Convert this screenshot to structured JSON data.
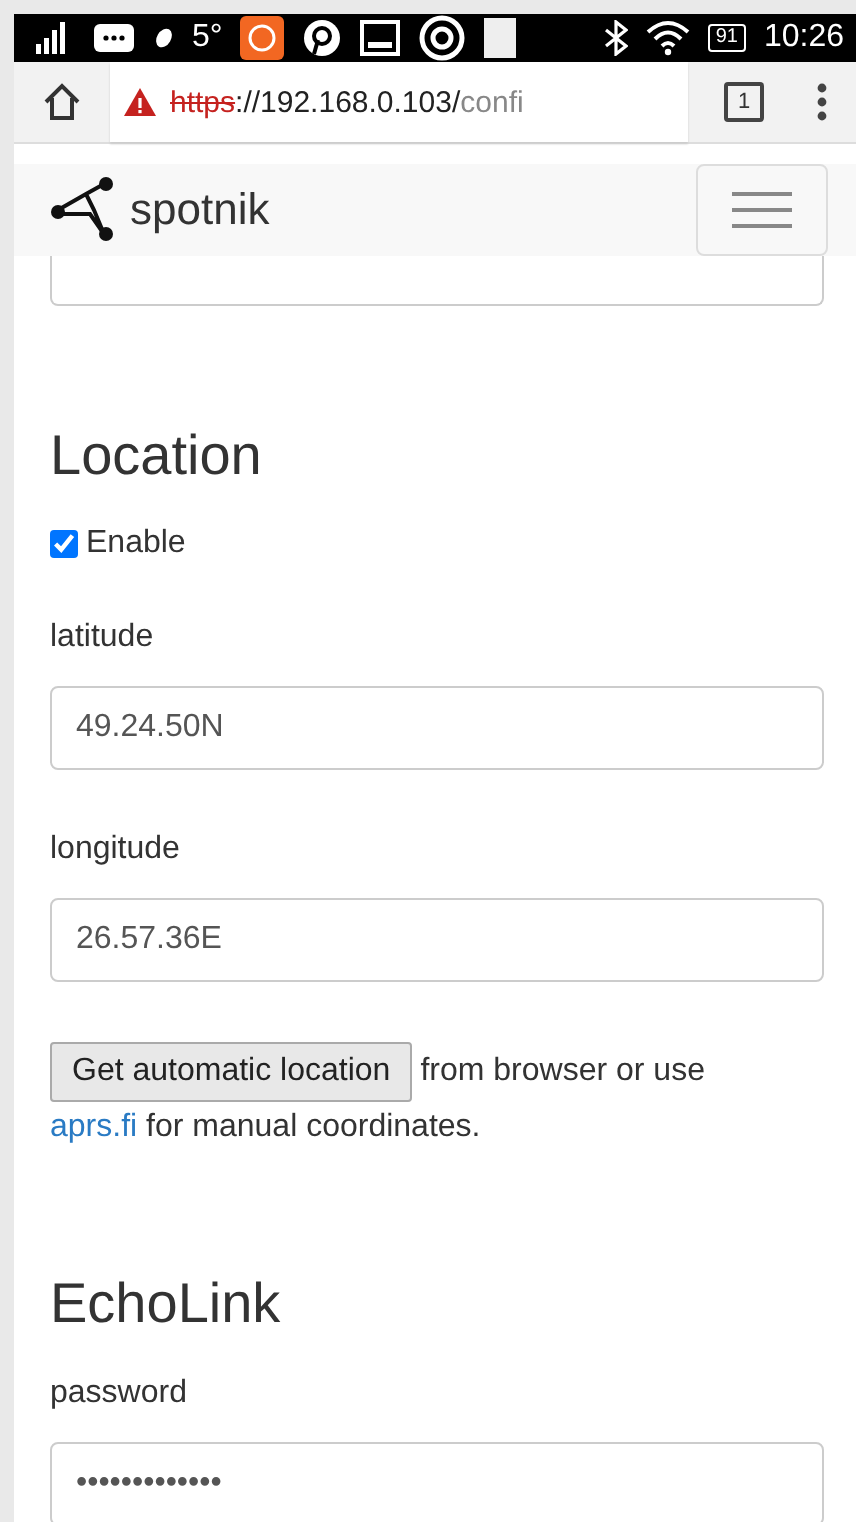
{
  "status_bar": {
    "temperature": "5°",
    "battery": "91",
    "time": "10:26"
  },
  "browser": {
    "url": {
      "scheme": "https",
      "host": "://192.168.0.103/",
      "path": "confi"
    },
    "insecure": true,
    "tab_count": "1"
  },
  "navbar": {
    "brand": "spotnik"
  },
  "form": {
    "sections": [
      {
        "heading": "Location",
        "fields": [
          {
            "kind": "checkbox",
            "label": "Enable",
            "checked": true
          },
          {
            "kind": "text",
            "label": "latitude",
            "value": "49.24.50N"
          },
          {
            "kind": "text",
            "label": "longitude",
            "value": "26.57.36E"
          },
          {
            "kind": "locate",
            "button": "Get automatic location",
            "text_before": "from browser or use",
            "link": "aprs.fi",
            "text_after": "for manual coordinates."
          }
        ]
      },
      {
        "heading": "EchoLink",
        "fields": [
          {
            "kind": "password",
            "label": "password",
            "value": "•••••••••••••"
          }
        ]
      }
    ]
  }
}
